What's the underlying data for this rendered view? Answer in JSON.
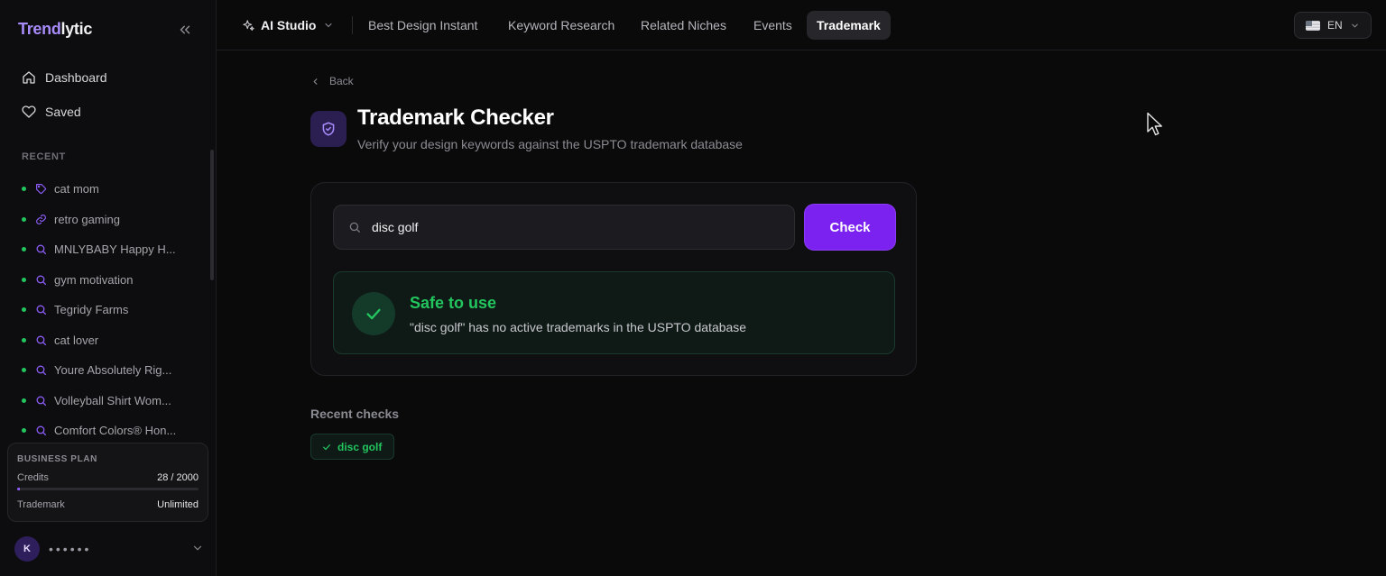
{
  "brand": {
    "part1": "Trend",
    "part2": "lytic"
  },
  "sidebar": {
    "nav": [
      {
        "label": "Dashboard",
        "icon": "home-icon"
      },
      {
        "label": "Saved",
        "icon": "heart-icon"
      }
    ],
    "recent_label": "RECENT",
    "recent": [
      {
        "label": "cat mom",
        "icon": "tag-icon"
      },
      {
        "label": "retro gaming",
        "icon": "link-icon"
      },
      {
        "label": "MNLYBABY Happy H...",
        "icon": "search-icon"
      },
      {
        "label": "gym motivation",
        "icon": "search-icon"
      },
      {
        "label": "Tegridy Farms",
        "icon": "search-icon"
      },
      {
        "label": "cat lover",
        "icon": "search-icon"
      },
      {
        "label": "Youre Absolutely Rig...",
        "icon": "search-icon"
      },
      {
        "label": "Volleyball Shirt Wom...",
        "icon": "search-icon"
      },
      {
        "label": "Comfort Colors® Hon...",
        "icon": "search-icon"
      }
    ],
    "plan": {
      "title": "BUSINESS PLAN",
      "credits_label": "Credits",
      "credits_value": "28 / 2000",
      "credits_used": 28,
      "credits_total": 2000,
      "trademark_label": "Trademark",
      "trademark_value": "Unlimited"
    },
    "user": {
      "initial": "K",
      "name": "••••••"
    }
  },
  "topbar": {
    "ai_studio": "AI Studio",
    "links": [
      "Best Design Instant",
      "Keyword Research",
      "Related Niches",
      "Events",
      "Trademark"
    ],
    "active": "Trademark",
    "language": "EN"
  },
  "main": {
    "back": "Back",
    "title": "Trademark Checker",
    "subtitle": "Verify your design keywords against the USPTO trademark database",
    "search_value": "disc golf",
    "check_button": "Check",
    "result": {
      "status": "Safe to use",
      "message": "\"disc golf\" has no active trademarks in the USPTO database"
    },
    "recent_title": "Recent checks",
    "recent_checks": [
      "disc golf"
    ]
  },
  "colors": {
    "accent": "#7c22f0",
    "brand_purple": "#a78bfa",
    "success": "#22c55e",
    "background": "#0a0a0b"
  }
}
